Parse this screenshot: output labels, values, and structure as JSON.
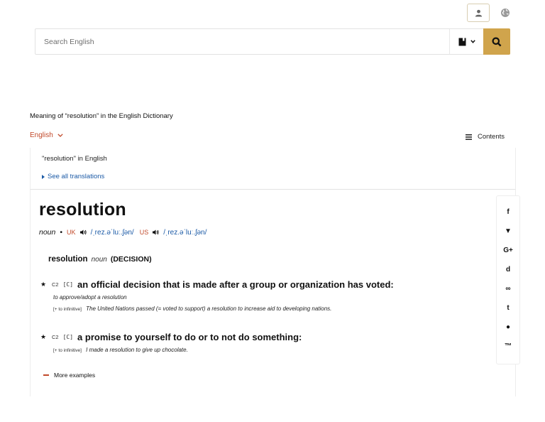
{
  "header": {
    "user_icon": "user-icon",
    "globe_icon": "globe-icon"
  },
  "search": {
    "placeholder": "Search English",
    "dictionary_icon": "book-icon",
    "submit_icon": "search-icon"
  },
  "page": {
    "meaning_title": "Meaning of “resolution” in the English Dictionary",
    "language": "English",
    "contents_label": "Contents"
  },
  "translations": {
    "in_english": "\"resolution\" in English",
    "see_all": "See all translations"
  },
  "entry": {
    "headword": "resolution",
    "pos": "noun",
    "uk_label": "UK",
    "uk_ipa": "/ˌrez.əˈluː.ʃən/",
    "us_label": "US",
    "us_ipa": "/ˌrez.əˈluː.ʃən/",
    "guide_head": "resolution",
    "guide_pos": "noun",
    "guide_word": "(DECISION)",
    "senses": [
      {
        "level": "C2",
        "gram": "[C]",
        "definition": "an official decision that is made after a group or organization has voted:",
        "examples": [
          {
            "gram": "",
            "text": "to approve/adopt a resolution"
          },
          {
            "gram": "[+ to infinitive]",
            "text": "The United Nations passed (= voted to support) a resolution to increase aid to developing nations."
          }
        ]
      },
      {
        "level": "C2",
        "gram": "[C]",
        "definition": "a promise to yourself to do or to not do something:",
        "examples": [
          {
            "gram": "[+ to infinitive]",
            "text": "I made a resolution to give up chocolate."
          }
        ]
      }
    ],
    "more_examples": "More examples"
  },
  "share": [
    {
      "name": "facebook-icon",
      "glyph": "f"
    },
    {
      "name": "twitter-icon",
      "glyph": "▼"
    },
    {
      "name": "google-plus-icon",
      "glyph": "G+"
    },
    {
      "name": "delicious-icon",
      "glyph": "d"
    },
    {
      "name": "stumbleupon-icon",
      "glyph": "∞"
    },
    {
      "name": "tumblr-icon",
      "glyph": "t"
    },
    {
      "name": "reddit-icon",
      "glyph": "●"
    },
    {
      "name": "link-icon",
      "glyph": "™"
    }
  ],
  "colors": {
    "accent": "#d0a44c",
    "link": "#1b5aa6",
    "region": "#c1492a"
  }
}
